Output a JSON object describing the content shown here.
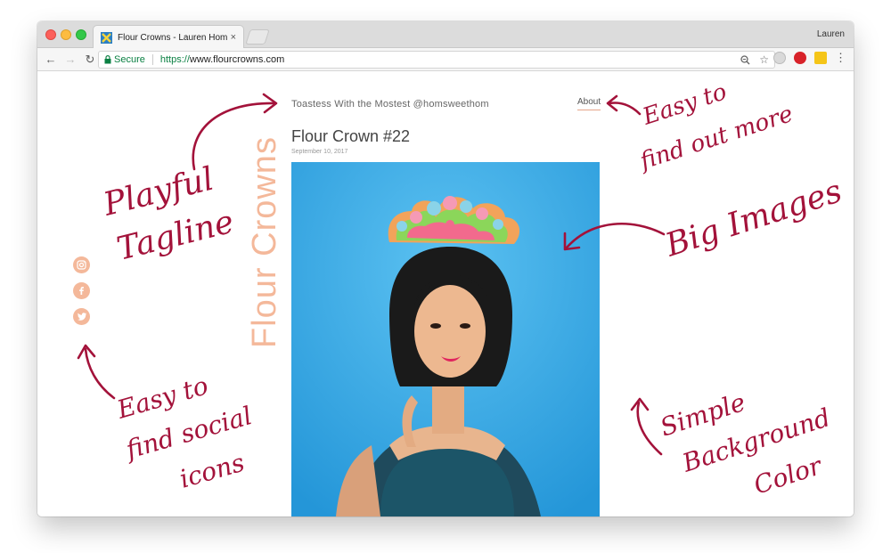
{
  "browser": {
    "tab_title": "Flour Crowns - Lauren Hom",
    "tab_close": "×",
    "profile_name": "Lauren",
    "secure_label": "Secure",
    "url_scheme": "https://",
    "url_host": "www.flourcrowns.com"
  },
  "site": {
    "tagline": "Toastess With the Mostest @homsweethom",
    "about_label": "About",
    "post_title": "Flour Crown #22",
    "post_date": "September 10, 2017",
    "logo_text": "Flour Crowns",
    "social_icons": [
      "instagram-icon",
      "facebook-icon",
      "twitter-icon"
    ]
  },
  "annotations": {
    "tagline_note": [
      "Playful",
      "Tagline"
    ],
    "about_note": [
      "Easy to",
      "find out more"
    ],
    "images_note": [
      "Big Images"
    ],
    "social_note": [
      "Easy to",
      "find social",
      "icons"
    ],
    "background_note": [
      "Simple",
      "Background",
      "Color"
    ]
  },
  "colors": {
    "accent_peach": "#f4b89a",
    "annotation_red": "#a3123a",
    "photo_bg": "#3aa9e6"
  }
}
